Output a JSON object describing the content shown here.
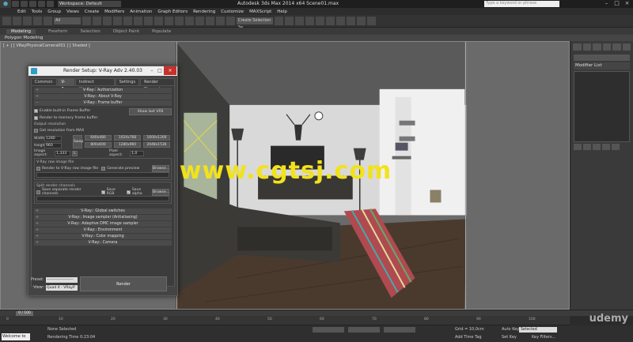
{
  "titlebar": {
    "workspace": "Workspace: Default",
    "title": "Autodesk 3ds Max  2014 x64      Scene01.max",
    "search_placeholder": "Type a keyword or phrase"
  },
  "menu": [
    "Edit",
    "Tools",
    "Group",
    "Views",
    "Create",
    "Modifiers",
    "Animation",
    "Graph Editors",
    "Rendering",
    "Customize",
    "MAXScript",
    "Help"
  ],
  "toolbar": {
    "selection_filter": "All",
    "selection_set": "Create Selection Se"
  },
  "ribbon": {
    "tabs": [
      "Modeling",
      "Freeform",
      "Selection",
      "Object Paint",
      "Populate"
    ],
    "sub_label": "Polygon Modeling"
  },
  "viewport": {
    "label": "[ + ] [ VRayPhysicalCamera001 ] [ Shaded ]",
    "watermark": "www.cgtsj.com"
  },
  "command_panel": {
    "modifier_list": "Modifier List"
  },
  "dialog": {
    "title": "Render Setup: V-Ray Adv 2.40.03",
    "tabs": [
      "Common",
      "V-Ray",
      "Indirect illumination",
      "Settings",
      "Render Elements"
    ],
    "rollouts_top": [
      "V-Ray:: Authorization",
      "V-Ray:: About V-Ray",
      "V-Ray:: Frame buffer"
    ],
    "enable_vfb": "Enable built-in Frame Buffer",
    "render_memory": "Render to memory frame buffer",
    "show_last_vfb": "Show last VFB",
    "output_resolution": "Output resolution",
    "get_from_max": "Get resolution from MAX",
    "width_label": "Width",
    "height_label": "Height",
    "swap_label": "Swap",
    "width_value": "1280",
    "height_value": "960",
    "presets": [
      "640x480",
      "1024x768",
      "1600x1200",
      "800x600",
      "1280x960",
      "2048x1536"
    ],
    "image_aspect_label": "Image aspect:",
    "image_aspect_value": "1,333",
    "lock_label": "L",
    "pixel_aspect_label": "Pixel aspect:",
    "pixel_aspect_value": "1,0",
    "raw_image_label": "V-Ray raw image file",
    "render_raw": "Render to V-Ray raw image file",
    "generate_preview": "Generate preview",
    "browse": "Browse...",
    "split_label": "Split render channels",
    "save_separate": "Save separate render channels",
    "save_rgb": "Save RGB",
    "save_alpha": "Save alpha",
    "rollouts_bottom": [
      "V-Ray:: Global switches",
      "V-Ray:: Image sampler (Antialiasing)",
      "V-Ray:: Adaptive DMC image sampler",
      "V-Ray:: Environment",
      "V-Ray:: Color mapping",
      "V-Ray:: Camera"
    ],
    "preset_label": "Preset:",
    "preset_value": "--------------------",
    "view_label": "View:",
    "view_value": "Quad 4 - VRayP",
    "render_button": "Render"
  },
  "timeline": {
    "slider": "0 / 100",
    "ticks": [
      "0",
      "10",
      "20",
      "30",
      "40",
      "50",
      "60",
      "70",
      "80",
      "90",
      "100"
    ]
  },
  "status": {
    "listener": "Welcome to M",
    "selection": "None Selected",
    "rendering_time": "Rendering Time  0:23:04",
    "grid": "Grid = 10,0cm",
    "auto_key": "Auto Key",
    "selected": "Selected",
    "set_key": "Set Key",
    "key_filters": "Key Filters...",
    "add_time_tag": "Add Time Tag"
  },
  "brand": "udemy",
  "colors": {
    "watermark": "#f2e21a",
    "close_button": "#c8302c",
    "vray_logo": "#2f9ec9"
  }
}
